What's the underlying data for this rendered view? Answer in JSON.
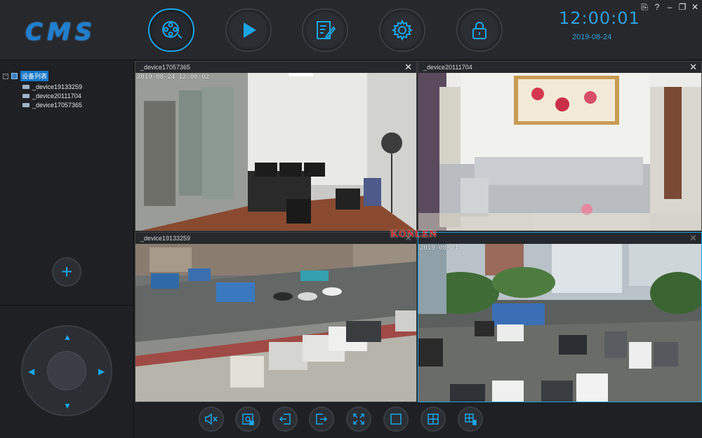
{
  "header": {
    "logo": "CMS",
    "clock": "12:00:01",
    "date": "2019-08-24",
    "window_controls": [
      "⎘",
      "?",
      "–",
      "❐",
      "✕"
    ],
    "nav": [
      {
        "name": "preview-nav-button",
        "icon": "film-reel-icon",
        "active": true
      },
      {
        "name": "playback-nav-button",
        "icon": "play-icon",
        "active": false
      },
      {
        "name": "log-nav-button",
        "icon": "edit-document-icon",
        "active": false
      },
      {
        "name": "settings-nav-button",
        "icon": "gear-icon",
        "active": false
      },
      {
        "name": "lock-nav-button",
        "icon": "lock-icon",
        "active": false
      }
    ]
  },
  "sidebar": {
    "tree_toggle": "−",
    "root_label": "设备列表",
    "devices": [
      "_device19133259",
      "_device20111704",
      "_device17057365"
    ],
    "add_label": "+",
    "ptz_arrows": {
      "up": "▲",
      "down": "▼",
      "left": "◀",
      "right": "▶"
    }
  },
  "tiles": [
    {
      "title": "_device17057365",
      "osd": "2019-08-24 12:00:02",
      "close": "✕"
    },
    {
      "title": "_device20111704",
      "osd": "",
      "close": "✕"
    },
    {
      "title": "_device19133259",
      "osd": "",
      "close": "✕"
    },
    {
      "title": "",
      "osd": "2019-08-24",
      "close": "✕"
    }
  ],
  "watermark": "KONLEN",
  "toolbar": [
    {
      "name": "mute-button",
      "icon": "speaker-mute-icon"
    },
    {
      "name": "snapshot-button",
      "icon": "capture-icon"
    },
    {
      "name": "previous-page-button",
      "icon": "page-prev-icon"
    },
    {
      "name": "next-page-button",
      "icon": "page-next-icon"
    },
    {
      "name": "fullscreen-button",
      "icon": "fullscreen-icon"
    },
    {
      "name": "layout-1-button",
      "icon": "single-view-icon"
    },
    {
      "name": "layout-4-button",
      "icon": "quad-view-icon"
    },
    {
      "name": "layout-custom-button",
      "icon": "multi-view-icon"
    }
  ],
  "colors": {
    "accent": "#1aa6e6",
    "background": "#1e2023",
    "panel": "#26282c"
  }
}
